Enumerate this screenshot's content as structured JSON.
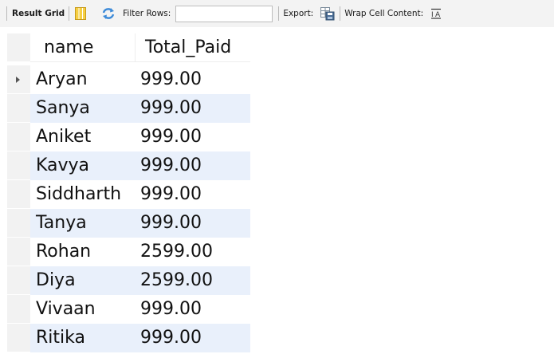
{
  "toolbar": {
    "result_grid_label": "Result Grid",
    "filter_rows_label": "Filter Rows:",
    "filter_value": "",
    "export_label": "Export:",
    "wrap_label": "Wrap Cell Content:",
    "icons": {
      "grid_view": "grid-icon",
      "refresh": "refresh-icon",
      "export": "export-icon",
      "wrap": "wrap-text-icon"
    }
  },
  "grid": {
    "columns": [
      "name",
      "Total_Paid"
    ],
    "rows": [
      {
        "name": "Aryan",
        "total_paid": "999.00"
      },
      {
        "name": "Sanya",
        "total_paid": "999.00"
      },
      {
        "name": "Aniket",
        "total_paid": "999.00"
      },
      {
        "name": "Kavya",
        "total_paid": "999.00"
      },
      {
        "name": "Siddharth",
        "total_paid": "999.00"
      },
      {
        "name": "Tanya",
        "total_paid": "999.00"
      },
      {
        "name": "Rohan",
        "total_paid": "2599.00"
      },
      {
        "name": "Diya",
        "total_paid": "2599.00"
      },
      {
        "name": "Vivaan",
        "total_paid": "999.00"
      },
      {
        "name": "Ritika",
        "total_paid": "999.00"
      }
    ],
    "current_row_index": 0
  },
  "colors": {
    "alt_row": "#e9f0fb",
    "toolbar_bg": "#f3f3f3"
  }
}
